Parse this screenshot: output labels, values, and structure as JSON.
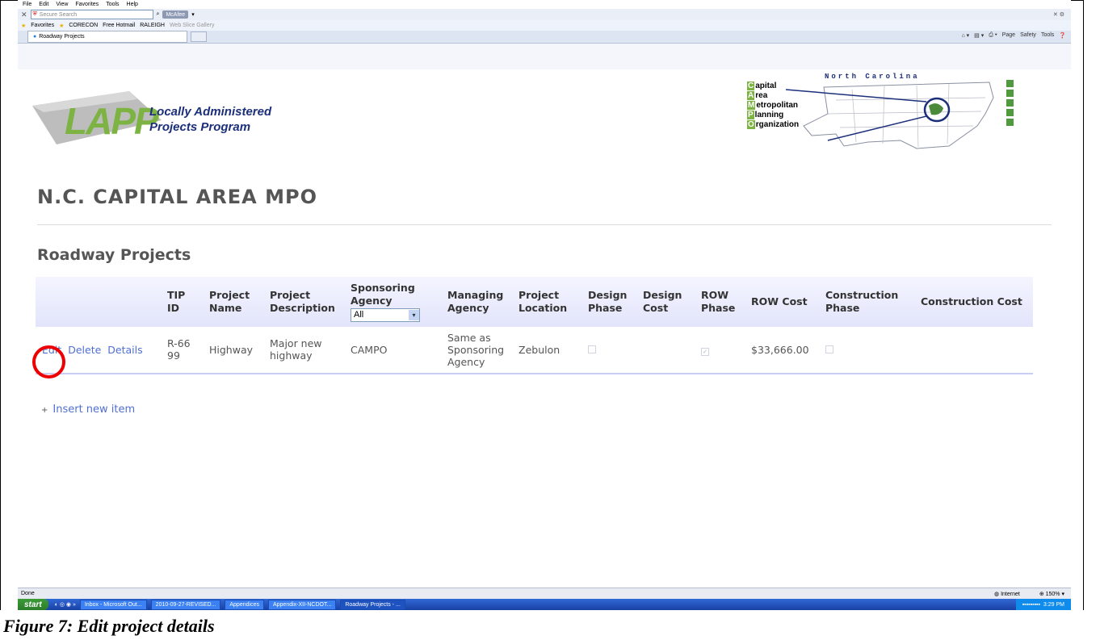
{
  "browser": {
    "menu": [
      "File",
      "Edit",
      "View",
      "Favorites",
      "Tools",
      "Help"
    ],
    "search_placeholder": "Secure Search",
    "mcafee_label": "McAfee",
    "favorites_label": "Favorites",
    "favorites_links": [
      "CORECON",
      "Free Hotmail",
      "RALEIGH",
      "Web Slice Gallery"
    ],
    "tab_title": "Roadway Projects",
    "command_bar": [
      "Page",
      "Safety",
      "Tools"
    ],
    "status_text": "Done",
    "zone_text": "Internet",
    "zoom_text": "150%"
  },
  "banner": {
    "lapp_big": "LAPP",
    "lapp_sub1": "Locally Administered",
    "lapp_sub2": "Projects Program",
    "campo_state": "North Carolina",
    "campo_words": [
      {
        "initial": "C",
        "rest": "apital"
      },
      {
        "initial": "A",
        "rest": "rea"
      },
      {
        "initial": "M",
        "rest": "etropolitan"
      },
      {
        "initial": "P",
        "rest": "lanning"
      },
      {
        "initial": "O",
        "rest": "rganization"
      }
    ]
  },
  "page": {
    "heading": "N.C. CAPITAL AREA MPO",
    "subheading": "Roadway Projects",
    "insert_label": "Insert new item"
  },
  "table": {
    "headers": {
      "tip": "TIP ID",
      "name": "Project Name",
      "desc": "Project Description",
      "sponsor": "Sponsoring Agency",
      "managing": "Managing Agency",
      "location": "Project Location",
      "design_phase": "Design Phase",
      "design_cost": "Design Cost",
      "row_phase": "ROW Phase",
      "row_cost": "ROW Cost",
      "const_phase": "Construction Phase",
      "const_cost": "Construction Cost"
    },
    "filter_value": "All",
    "row": {
      "edit": "Edit",
      "delete": "Delete",
      "details": "Details",
      "tip": "R-6699",
      "name": "Highway",
      "desc": "Major new highway",
      "sponsor": "CAMPO",
      "managing": "Same as Sponsoring Agency",
      "location": "Zebulon",
      "design_phase": false,
      "design_cost": "",
      "row_phase": true,
      "row_cost": "$33,666.00",
      "const_phase": false,
      "const_cost": ""
    }
  },
  "taskbar": {
    "start": "start",
    "items": [
      "Inbox - Microsoft Out...",
      "2010-09-27-REVISED...",
      "Appendices",
      "Appendix-XII-NCDOT...",
      "Roadway Projects - ..."
    ],
    "clock": "3:29 PM"
  },
  "caption": "Figure 7: Edit project details"
}
